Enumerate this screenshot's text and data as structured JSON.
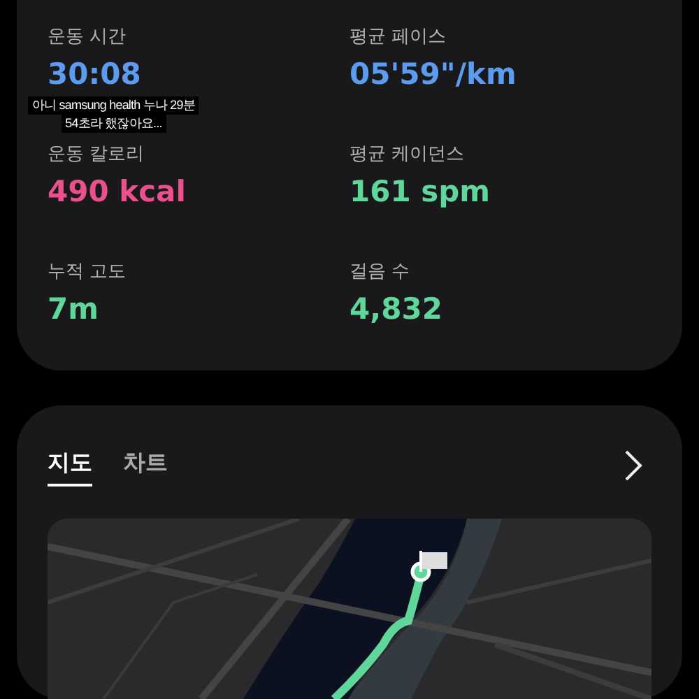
{
  "stats": [
    {
      "label": "운동 시간",
      "value": "30:08",
      "color": "#5b9cf0"
    },
    {
      "label": "평균 페이스",
      "value": "05'59\"/km",
      "color": "#5b9cf0"
    },
    {
      "label": "운동 칼로리",
      "value": "490 kcal",
      "color": "#ec4f8e"
    },
    {
      "label": "평균 케이던스",
      "value": "161 spm",
      "color": "#5fd69a"
    },
    {
      "label": "누적 고도",
      "value": "7m",
      "color": "#5fd69a"
    },
    {
      "label": "걸음 수",
      "value": "4,832",
      "color": "#5fd69a"
    }
  ],
  "caption": {
    "lines": [
      "아니 samsung health 누나 29분",
      "54초라 했잖아요..."
    ]
  },
  "tabs": [
    {
      "label": "지도",
      "selected": true
    },
    {
      "label": "차트",
      "selected": false
    }
  ]
}
